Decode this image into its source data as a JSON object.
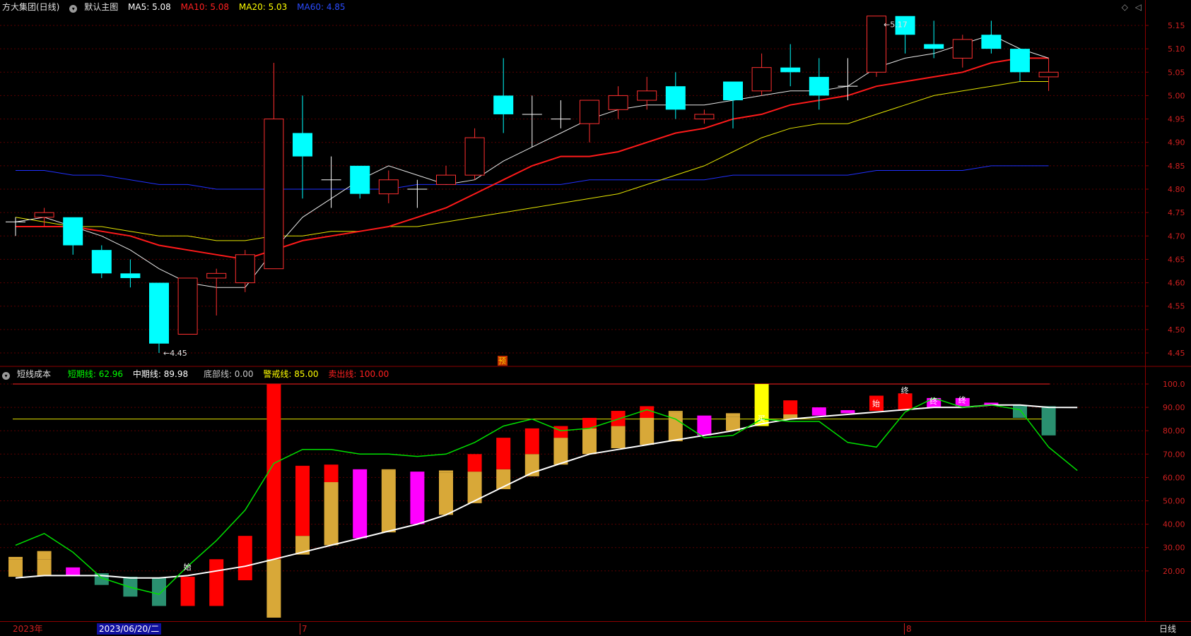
{
  "price_pane": {
    "stock_name": "方大集团(日线)",
    "template": "默认主图",
    "ma": [
      {
        "label": "MA5: 5.08",
        "color": "#ffffff"
      },
      {
        "label": "MA10: 5.08",
        "color": "#ff2020"
      },
      {
        "label": "MA20: 5.03",
        "color": "#ffff00"
      },
      {
        "label": "MA60: 4.85",
        "color": "#2040ff"
      }
    ],
    "y_ticks": [
      "5.15",
      "5.10",
      "5.05",
      "5.00",
      "4.95",
      "4.90",
      "4.85",
      "4.80",
      "4.75",
      "4.70",
      "4.65",
      "4.60",
      "4.55",
      "4.50",
      "4.45"
    ],
    "low_marker": "4.45",
    "high_marker": "5.17",
    "pre_marker": "预"
  },
  "indicator_pane": {
    "name": "短线成本",
    "lines": [
      {
        "label": "短期线: 62.96",
        "color": "#00ff00"
      },
      {
        "label": "中期线: 89.98",
        "color": "#ffffff"
      },
      {
        "label": "底部线: 0.00",
        "color": "#c8c8c8"
      },
      {
        "label": "警戒线: 85.00",
        "color": "#ffff00"
      },
      {
        "label": "卖出线: 100.00",
        "color": "#ff2020"
      }
    ],
    "y_ticks": [
      "100.0",
      "90.00",
      "80.00",
      "70.00",
      "60.00",
      "50.00",
      "40.00",
      "30.00",
      "20.00"
    ],
    "markers": {
      "start": "始",
      "end": "终",
      "buy": "买"
    }
  },
  "bottom_bar": {
    "year": "2023年",
    "cursor_date": "2023/06/20/二",
    "month_7": "7",
    "month_8": "8",
    "period": "日线"
  },
  "chart_data": {
    "type": "candlestick",
    "candles": [
      {
        "o": 4.73,
        "h": 4.74,
        "l": 4.7,
        "c": 4.73
      },
      {
        "o": 4.74,
        "h": 4.76,
        "l": 4.72,
        "c": 4.75
      },
      {
        "o": 4.74,
        "h": 4.74,
        "l": 4.66,
        "c": 4.68
      },
      {
        "o": 4.67,
        "h": 4.68,
        "l": 4.61,
        "c": 4.62
      },
      {
        "o": 4.62,
        "h": 4.65,
        "l": 4.59,
        "c": 4.61
      },
      {
        "o": 4.6,
        "h": 4.6,
        "l": 4.45,
        "c": 4.47
      },
      {
        "o": 4.49,
        "h": 4.61,
        "l": 4.49,
        "c": 4.61
      },
      {
        "o": 4.61,
        "h": 4.63,
        "l": 4.53,
        "c": 4.62
      },
      {
        "o": 4.6,
        "h": 4.67,
        "l": 4.58,
        "c": 4.66
      },
      {
        "o": 4.63,
        "h": 5.07,
        "l": 4.63,
        "c": 4.95
      },
      {
        "o": 4.92,
        "h": 5.0,
        "l": 4.78,
        "c": 4.87
      },
      {
        "o": 4.82,
        "h": 4.87,
        "l": 4.76,
        "c": 4.82
      },
      {
        "o": 4.85,
        "h": 4.85,
        "l": 4.78,
        "c": 4.79
      },
      {
        "o": 4.79,
        "h": 4.84,
        "l": 4.77,
        "c": 4.82
      },
      {
        "o": 4.8,
        "h": 4.82,
        "l": 4.76,
        "c": 4.8
      },
      {
        "o": 4.81,
        "h": 4.85,
        "l": 4.81,
        "c": 4.83
      },
      {
        "o": 4.83,
        "h": 4.93,
        "l": 4.82,
        "c": 4.91
      },
      {
        "o": 5.0,
        "h": 5.08,
        "l": 4.92,
        "c": 4.96
      },
      {
        "o": 4.96,
        "h": 5.0,
        "l": 4.89,
        "c": 4.96
      },
      {
        "o": 4.95,
        "h": 4.99,
        "l": 4.93,
        "c": 4.95
      },
      {
        "o": 4.94,
        "h": 4.99,
        "l": 4.9,
        "c": 4.99
      },
      {
        "o": 4.97,
        "h": 5.02,
        "l": 4.95,
        "c": 5.0
      },
      {
        "o": 4.99,
        "h": 5.04,
        "l": 4.97,
        "c": 5.01
      },
      {
        "o": 5.02,
        "h": 5.05,
        "l": 4.95,
        "c": 4.97
      },
      {
        "o": 4.95,
        "h": 4.97,
        "l": 4.94,
        "c": 4.96
      },
      {
        "o": 5.03,
        "h": 5.03,
        "l": 4.93,
        "c": 4.99
      },
      {
        "o": 5.01,
        "h": 5.09,
        "l": 5.0,
        "c": 5.06
      },
      {
        "o": 5.06,
        "h": 5.11,
        "l": 5.02,
        "c": 5.05
      },
      {
        "o": 5.04,
        "h": 5.08,
        "l": 4.97,
        "c": 5.0
      },
      {
        "o": 5.02,
        "h": 5.08,
        "l": 4.99,
        "c": 5.02
      },
      {
        "o": 5.05,
        "h": 5.17,
        "l": 5.04,
        "c": 5.17
      },
      {
        "o": 5.17,
        "h": 5.17,
        "l": 5.09,
        "c": 5.13
      },
      {
        "o": 5.11,
        "h": 5.16,
        "l": 5.08,
        "c": 5.1
      },
      {
        "o": 5.08,
        "h": 5.13,
        "l": 5.06,
        "c": 5.12
      },
      {
        "o": 5.13,
        "h": 5.16,
        "l": 5.09,
        "c": 5.1
      },
      {
        "o": 5.1,
        "h": 5.1,
        "l": 5.03,
        "c": 5.05
      },
      {
        "o": 5.04,
        "h": 5.08,
        "l": 5.01,
        "c": 5.05
      }
    ],
    "ma5": [
      4.73,
      4.74,
      4.72,
      4.7,
      4.67,
      4.63,
      4.6,
      4.59,
      4.59,
      4.67,
      4.74,
      4.78,
      4.82,
      4.85,
      4.83,
      4.81,
      4.82,
      4.86,
      4.89,
      4.92,
      4.95,
      4.97,
      4.98,
      4.98,
      4.98,
      4.99,
      5.0,
      5.01,
      5.01,
      5.02,
      5.06,
      5.08,
      5.09,
      5.11,
      5.13,
      5.1,
      5.08
    ],
    "ma10": [
      4.72,
      4.72,
      4.72,
      4.71,
      4.7,
      4.68,
      4.67,
      4.66,
      4.65,
      4.67,
      4.69,
      4.7,
      4.71,
      4.72,
      4.74,
      4.76,
      4.79,
      4.82,
      4.85,
      4.87,
      4.87,
      4.88,
      4.9,
      4.92,
      4.93,
      4.95,
      4.96,
      4.98,
      4.99,
      5.0,
      5.02,
      5.03,
      5.04,
      5.05,
      5.07,
      5.08,
      5.08
    ],
    "ma20": [
      4.74,
      4.73,
      4.72,
      4.72,
      4.71,
      4.7,
      4.7,
      4.69,
      4.69,
      4.7,
      4.7,
      4.71,
      4.71,
      4.72,
      4.72,
      4.73,
      4.74,
      4.75,
      4.76,
      4.77,
      4.78,
      4.79,
      4.81,
      4.83,
      4.85,
      4.88,
      4.91,
      4.93,
      4.94,
      4.94,
      4.96,
      4.98,
      5.0,
      5.01,
      5.02,
      5.03,
      5.03
    ],
    "ma60": [
      4.84,
      4.84,
      4.83,
      4.83,
      4.82,
      4.81,
      4.81,
      4.8,
      4.8,
      4.8,
      4.8,
      4.8,
      4.8,
      4.8,
      4.81,
      4.81,
      4.81,
      4.81,
      4.81,
      4.81,
      4.82,
      4.82,
      4.82,
      4.82,
      4.82,
      4.83,
      4.83,
      4.83,
      4.83,
      4.83,
      4.84,
      4.84,
      4.84,
      4.84,
      4.85,
      4.85,
      4.85
    ],
    "indicator": {
      "short_line": [
        31,
        36,
        28,
        17,
        13,
        10,
        22,
        33,
        46,
        66,
        72,
        72,
        70,
        70,
        69,
        70,
        75,
        82,
        85,
        80,
        81,
        85,
        89,
        85,
        77,
        78,
        85,
        84,
        84,
        75,
        73,
        88,
        94,
        90,
        91,
        89,
        73,
        62.96
      ],
      "mid_line": [
        17,
        18,
        18,
        18,
        17,
        17,
        18,
        20,
        22,
        25,
        28,
        31,
        34,
        37,
        40,
        44,
        50,
        56,
        62,
        66,
        70,
        72,
        74,
        76,
        78,
        80,
        83,
        85,
        86,
        87,
        88,
        89,
        90,
        90,
        91,
        91,
        90,
        89.98
      ],
      "warning": 85,
      "sell": 100,
      "bottom": 0,
      "bars": [
        {
          "lo": 17.5,
          "mid": 25,
          "hi": 26,
          "col": "gold"
        },
        {
          "lo": 18.0,
          "mid": 25,
          "hi": 28.5,
          "col": "gold"
        },
        {
          "lo": 18.0,
          "mid": 18,
          "hi": 21.5,
          "col": "magenta"
        },
        {
          "lo": 14.0,
          "mid": 14,
          "hi": 19.0,
          "col": "teal"
        },
        {
          "lo": 9.0,
          "mid": 9,
          "hi": 17.5,
          "col": "teal"
        },
        {
          "lo": 5.0,
          "mid": 5,
          "hi": 17.0,
          "col": "teal"
        },
        {
          "lo": 5.0,
          "mid": 5,
          "hi": 17.5,
          "col": "red"
        },
        {
          "lo": 5.0,
          "mid": 5,
          "hi": 25.0,
          "col": "red"
        },
        {
          "lo": 16.0,
          "mid": 16,
          "hi": 35.0,
          "col": "red"
        },
        {
          "lo": 0.0,
          "mid": 25,
          "hi": 100,
          "col": "red"
        },
        {
          "lo": 27.0,
          "mid": 35,
          "hi": 65,
          "col": "red"
        },
        {
          "lo": 31.0,
          "mid": 58,
          "hi": 65.5,
          "col": "red"
        },
        {
          "lo": 34.0,
          "mid": 34,
          "hi": 63.5,
          "col": "magenta"
        },
        {
          "lo": 36.5,
          "mid": 63,
          "hi": 63.5,
          "col": "gold"
        },
        {
          "lo": 40.0,
          "mid": 40,
          "hi": 62.5,
          "col": "magenta"
        },
        {
          "lo": 44.0,
          "mid": 62,
          "hi": 63.0,
          "col": "gold"
        },
        {
          "lo": 49.0,
          "mid": 62.5,
          "hi": 70,
          "col": "red"
        },
        {
          "lo": 55.0,
          "mid": 63.5,
          "hi": 77,
          "col": "red"
        },
        {
          "lo": 60.5,
          "mid": 70,
          "hi": 81,
          "col": "red"
        },
        {
          "lo": 65.5,
          "mid": 77,
          "hi": 82,
          "col": "red"
        },
        {
          "lo": 70.0,
          "mid": 81,
          "hi": 85.5,
          "col": "red"
        },
        {
          "lo": 72.5,
          "mid": 82,
          "hi": 88.5,
          "col": "red"
        },
        {
          "lo": 74.0,
          "mid": 85.5,
          "hi": 90.5,
          "col": "red"
        },
        {
          "lo": 75.5,
          "mid": 88,
          "hi": 88.5,
          "col": "gold"
        },
        {
          "lo": 78.0,
          "mid": 78,
          "hi": 86.5,
          "col": "magenta"
        },
        {
          "lo": 80.0,
          "mid": 86,
          "hi": 87.5,
          "col": "gold"
        },
        {
          "lo": 82.0,
          "mid": 82,
          "hi": 100,
          "col": "yellow"
        },
        {
          "lo": 85.0,
          "mid": 87,
          "hi": 93,
          "col": "red"
        },
        {
          "lo": 86.5,
          "mid": 86.5,
          "hi": 90,
          "col": "magenta"
        },
        {
          "lo": 87.5,
          "mid": 87.5,
          "hi": 88.8,
          "col": "magenta"
        },
        {
          "lo": 88.5,
          "mid": 88.5,
          "hi": 95,
          "col": "red"
        },
        {
          "lo": 89.0,
          "mid": 89,
          "hi": 96,
          "col": "red"
        },
        {
          "lo": 90.0,
          "mid": 90,
          "hi": 94,
          "col": "magenta"
        },
        {
          "lo": 90.5,
          "mid": 90.5,
          "hi": 94,
          "col": "magenta"
        },
        {
          "lo": 91.0,
          "mid": 91,
          "hi": 92,
          "col": "magenta"
        },
        {
          "lo": 85.5,
          "mid": 85.5,
          "hi": 91,
          "col": "teal"
        },
        {
          "lo": 78.0,
          "mid": 78,
          "hi": 90.5,
          "col": "teal"
        }
      ]
    }
  }
}
